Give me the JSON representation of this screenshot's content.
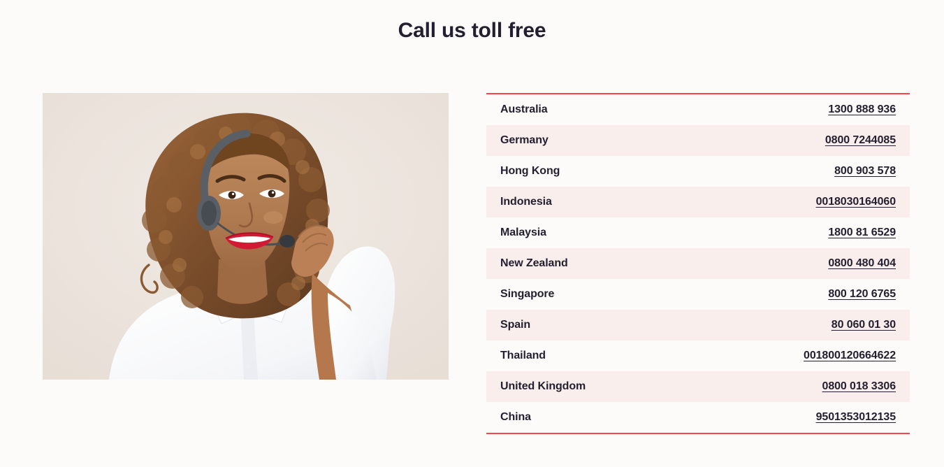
{
  "header": {
    "title": "Call us toll free"
  },
  "photo": {
    "alt": "Smiling female customer support agent wearing a headset",
    "background_color": "#ece5df",
    "shirt_color": "#ffffff",
    "hair_color": "#8a5a32",
    "skin_color": "#b57a52",
    "headset_color": "#5a5f66",
    "lip_color": "#d11a33"
  },
  "colors": {
    "page_background": "#fcfbf9",
    "accent_red": "#f4454c",
    "row_striped": "#faeeec",
    "text_dark": "#241f30"
  },
  "phone_table": {
    "rows": [
      {
        "country": "Australia",
        "number": "1300 888 936"
      },
      {
        "country": "Germany",
        "number": "0800 7244085"
      },
      {
        "country": "Hong Kong",
        "number": "800 903 578"
      },
      {
        "country": "Indonesia",
        "number": "0018030164060"
      },
      {
        "country": "Malaysia",
        "number": "1800 81 6529"
      },
      {
        "country": "New Zealand",
        "number": "0800 480 404"
      },
      {
        "country": "Singapore",
        "number": "800 120 6765"
      },
      {
        "country": "Spain",
        "number": "80 060 01 30"
      },
      {
        "country": "Thailand",
        "number": "001800120664622"
      },
      {
        "country": "United Kingdom",
        "number": "0800 018 3306"
      },
      {
        "country": "China",
        "number": "9501353012135"
      }
    ]
  }
}
